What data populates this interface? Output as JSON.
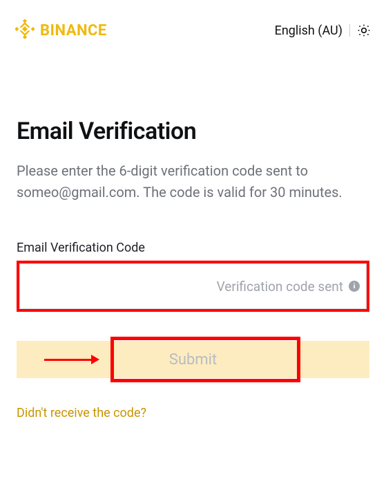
{
  "header": {
    "brand_name": "BINANCE",
    "language_label": "English (AU)"
  },
  "main": {
    "title": "Email Verification",
    "description": "Please enter the 6-digit verification code sent to someo@gmail.com. The code is valid for 30 minutes.",
    "field_label": "Email Verification Code",
    "input_helper": "Verification code sent",
    "submit_label": "Submit",
    "resend_label": "Didn't receive the code?"
  },
  "colors": {
    "brand": "#F0B90B",
    "highlight": "#ff0000"
  }
}
